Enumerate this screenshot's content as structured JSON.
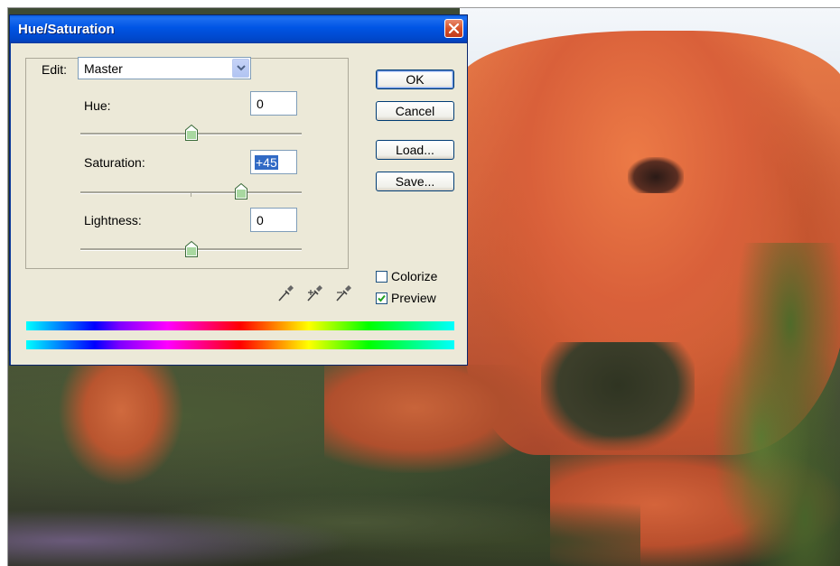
{
  "dialog": {
    "title": "Hue/Saturation",
    "edit": {
      "label": "Edit:",
      "selected": "Master"
    },
    "sliders": [
      {
        "label": "Hue:",
        "value": "0",
        "level": 0.5
      },
      {
        "label": "Saturation:",
        "value": "+45",
        "level": 0.725
      },
      {
        "label": "Lightness:",
        "value": "0",
        "level": 0.5
      }
    ],
    "buttons": {
      "ok": "OK",
      "cancel": "Cancel",
      "load": "Load...",
      "save": "Save..."
    },
    "checkboxes": {
      "colorize": {
        "label": "Colorize",
        "checked": false
      },
      "preview": {
        "label": "Preview",
        "checked": true
      }
    },
    "eyedroppers": [
      "eyedropper-icon",
      "eyedropper-plus-icon",
      "eyedropper-minus-icon"
    ]
  },
  "colors": {
    "titlebar": "#0055e5",
    "dialog_bg": "#ece9d8",
    "selection": "#316ac5"
  }
}
